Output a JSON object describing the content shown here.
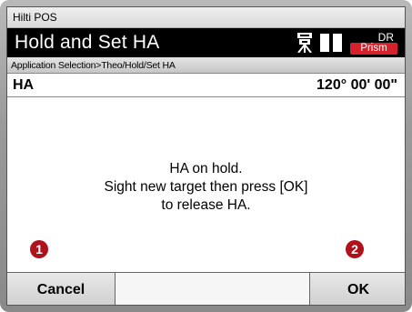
{
  "app": {
    "title": "Hilti POS"
  },
  "header": {
    "title": "Hold and Set HA",
    "mode_top": "DR",
    "mode_bottom": "Prism",
    "accent_color": "#d6212b"
  },
  "breadcrumb": "Application Selection>Theo/Hold/Set HA",
  "measurement": {
    "label": "HA",
    "value": "120° 00' 00\""
  },
  "message": {
    "line1": "HA on hold.",
    "line2": "Sight new target then press [OK]",
    "line3": "to release HA."
  },
  "softkeys": {
    "cancel": "Cancel",
    "ok": "OK"
  },
  "callouts": {
    "one": "1",
    "two": "2",
    "color": "#b0121c"
  },
  "icons": [
    "instrument-icon",
    "battery-icon",
    "battery-icon"
  ]
}
